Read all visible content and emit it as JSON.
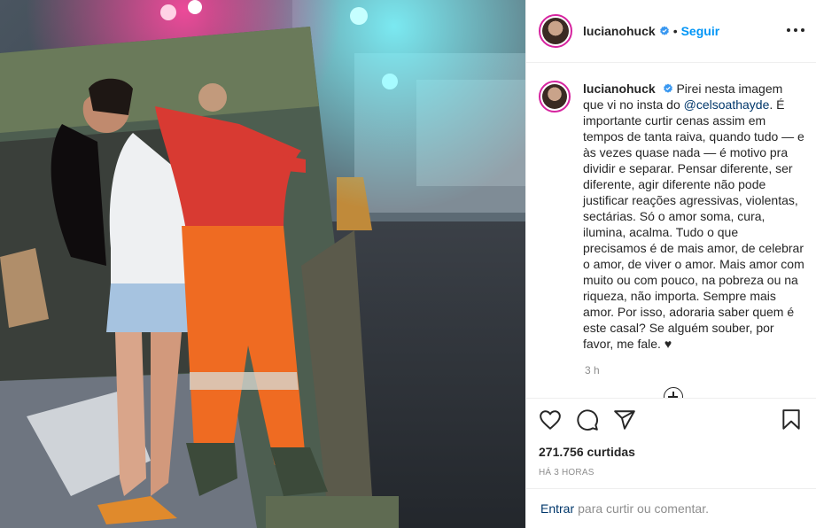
{
  "post": {
    "username": "lucianohuck",
    "separator": "•",
    "follow_label": "Seguir",
    "caption_username": "lucianohuck",
    "caption_before": "Pirei nesta imagem que vi no insta do ",
    "caption_mention": "@celsoathayde",
    "caption_after": ". É importante curtir cenas assim em tempos de tanta raiva, quando tudo — e às vezes quase nada — é motivo pra dividir e separar. Pensar diferente, ser diferente, agir diferente não pode justificar reações agressivas, violentas, sectárias. Só o amor soma, cura, ilumina, acalma. Tudo o que precisamos é de mais amor, de celebrar o amor, de viver o amor. Mais amor com muito ou com pouco, na pobreza ou na riqueza, não importa. Sempre mais amor. Por isso, adoraria saber quem é este casal? Se alguém souber, por favor, me fale. ♥",
    "caption_time": "3 h",
    "likes": "271.756 curtidas",
    "posted_ago": "HÁ 3 HORAS",
    "login_link": "Entrar",
    "login_rest": "para curtir ou comentar."
  },
  "icons": {
    "verified": "verified-badge-icon",
    "more": "more-options-icon",
    "like": "heart-icon",
    "comment": "comment-icon",
    "share": "share-icon",
    "save": "bookmark-icon",
    "load_more": "plus-circle-icon"
  },
  "colors": {
    "accent": "#0095f6",
    "mention": "#00376b",
    "muted": "#8e8e8e",
    "verified": "#3897f0",
    "story_ring": "#d6249f"
  }
}
